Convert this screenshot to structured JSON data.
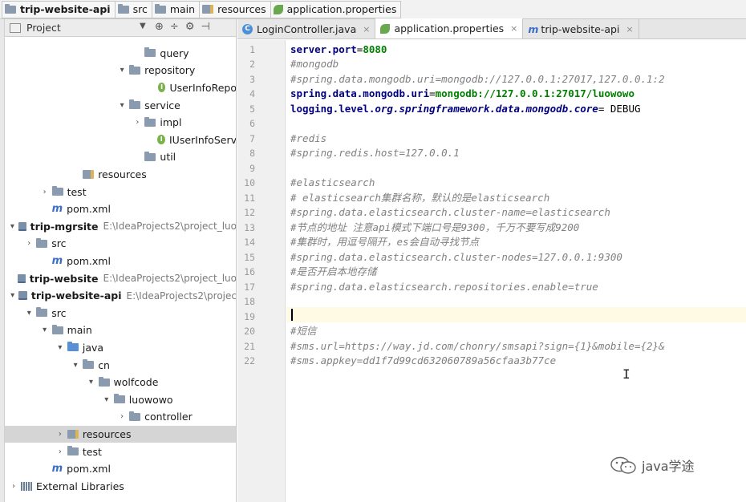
{
  "breadcrumb": [
    {
      "label": "trip-website-api",
      "icon": "module-folder-icon",
      "bold": true
    },
    {
      "label": "src",
      "icon": "folder-icon"
    },
    {
      "label": "main",
      "icon": "folder-icon"
    },
    {
      "label": "resources",
      "icon": "resources-folder-icon"
    },
    {
      "label": "application.properties",
      "icon": "spring-leaf-icon"
    }
  ],
  "project_panel": {
    "title": "Project",
    "tree": [
      {
        "label": "query",
        "depth": 8,
        "icon": "folder",
        "arrow": ""
      },
      {
        "label": "repository",
        "depth": 7,
        "icon": "folder",
        "arrow": "down"
      },
      {
        "label": "UserInfoRepo",
        "depth": 9,
        "icon": "interface",
        "arrow": ""
      },
      {
        "label": "service",
        "depth": 7,
        "icon": "folder",
        "arrow": "down"
      },
      {
        "label": "impl",
        "depth": 8,
        "icon": "folder",
        "arrow": "right"
      },
      {
        "label": "IUserInfoServ",
        "depth": 9,
        "icon": "interface",
        "arrow": ""
      },
      {
        "label": "util",
        "depth": 8,
        "icon": "folder",
        "arrow": ""
      },
      {
        "label": "resources",
        "depth": 4,
        "icon": "resources",
        "arrow": ""
      },
      {
        "label": "test",
        "depth": 2,
        "icon": "folder",
        "arrow": "right"
      },
      {
        "label": "pom.xml",
        "depth": 2,
        "icon": "maven",
        "arrow": ""
      },
      {
        "label": "trip-mgrsite",
        "path": "E:\\IdeaProjects2\\project_luo",
        "depth": 0,
        "icon": "module",
        "arrow": "down",
        "bold": true
      },
      {
        "label": "src",
        "depth": 1,
        "icon": "folder",
        "arrow": "right"
      },
      {
        "label": "pom.xml",
        "depth": 2,
        "icon": "maven",
        "arrow": ""
      },
      {
        "label": "trip-website",
        "path": "E:\\IdeaProjects2\\project_luo",
        "depth": 0,
        "icon": "module",
        "arrow": "",
        "bold": true
      },
      {
        "label": "trip-website-api",
        "path": "E:\\IdeaProjects2\\projec",
        "depth": 0,
        "icon": "module",
        "arrow": "down",
        "bold": true
      },
      {
        "label": "src",
        "depth": 1,
        "icon": "folder",
        "arrow": "down"
      },
      {
        "label": "main",
        "depth": 2,
        "icon": "folder",
        "arrow": "down"
      },
      {
        "label": "java",
        "depth": 3,
        "icon": "folder-blue",
        "arrow": "down"
      },
      {
        "label": "cn",
        "depth": 4,
        "icon": "folder",
        "arrow": "down"
      },
      {
        "label": "wolfcode",
        "depth": 5,
        "icon": "folder",
        "arrow": "down"
      },
      {
        "label": "luowowo",
        "depth": 6,
        "icon": "folder",
        "arrow": "down"
      },
      {
        "label": "controller",
        "depth": 7,
        "icon": "folder",
        "arrow": "right"
      },
      {
        "label": "resources",
        "depth": 3,
        "icon": "resources",
        "arrow": "right",
        "selected": true
      },
      {
        "label": "test",
        "depth": 3,
        "icon": "folder",
        "arrow": "right"
      },
      {
        "label": "pom.xml",
        "depth": 2,
        "icon": "maven",
        "arrow": ""
      },
      {
        "label": "External Libraries",
        "depth": 0,
        "icon": "library",
        "arrow": "right"
      }
    ]
  },
  "tabs": [
    {
      "label": "LoginController.java",
      "icon": "class-c-icon",
      "active": false
    },
    {
      "label": "application.properties",
      "icon": "spring-leaf-icon",
      "active": true
    },
    {
      "label": "trip-website-api",
      "icon": "maven-m-icon",
      "active": false
    }
  ],
  "editor": {
    "lines": [
      {
        "n": "1",
        "kind": "key",
        "key": "server.port",
        "eq": "=",
        "value": "8080"
      },
      {
        "n": "2",
        "kind": "comment",
        "text": "#mongodb"
      },
      {
        "n": "3",
        "kind": "comment",
        "text": "#spring.data.mongodb.uri=mongodb://127.0.0.1:27017,127.0.0.1:2"
      },
      {
        "n": "4",
        "kind": "key",
        "key": "spring.data.mongodb.uri",
        "eq": "=",
        "value": "mongodb://127.0.0.1:27017/luowowo"
      },
      {
        "n": "5",
        "kind": "key_italic",
        "key": "logging.level.",
        "ital": "org.springframework.data.mongodb.core",
        "eq": "= ",
        "value": "DEBUG"
      },
      {
        "n": "6",
        "kind": "empty",
        "text": ""
      },
      {
        "n": "7",
        "kind": "comment",
        "text": "#redis"
      },
      {
        "n": "8",
        "kind": "comment",
        "text": "#spring.redis.host=127.0.0.1"
      },
      {
        "n": "9",
        "kind": "empty",
        "text": ""
      },
      {
        "n": "10",
        "kind": "comment",
        "text": "#elasticsearch"
      },
      {
        "n": "11",
        "kind": "comment",
        "text": "# elasticsearch集群名称，默认的是elasticsearch"
      },
      {
        "n": "12",
        "kind": "comment",
        "text": "#spring.data.elasticsearch.cluster-name=elasticsearch"
      },
      {
        "n": "13",
        "kind": "comment",
        "text": "#节点的地址 注意api模式下端口号是9300，千万不要写成9200"
      },
      {
        "n": "14",
        "kind": "comment",
        "text": "#集群时，用逗号隔开，es会自动寻找节点"
      },
      {
        "n": "15",
        "kind": "comment",
        "text": "#spring.data.elasticsearch.cluster-nodes=127.0.0.1:9300"
      },
      {
        "n": "16",
        "kind": "comment",
        "text": "#是否开启本地存储"
      },
      {
        "n": "17",
        "kind": "comment",
        "text": "#spring.data.elasticsearch.repositories.enable=true"
      },
      {
        "n": "18",
        "kind": "empty",
        "text": ""
      },
      {
        "n": "19",
        "kind": "empty",
        "text": ""
      },
      {
        "n": "20",
        "kind": "comment",
        "text": "#短信"
      },
      {
        "n": "21",
        "kind": "comment",
        "text": "#sms.url=https://way.jd.com/chonry/smsapi?sign={1}&mobile={2}&"
      },
      {
        "n": "22",
        "kind": "comment",
        "text": "#sms.appkey=dd1f7d99cd632060789a56cfaa3b77ce"
      }
    ]
  },
  "watermark": {
    "text": "java学途",
    "icon": "wechat-icon"
  },
  "colors": {
    "key": "#000080",
    "value": "#008000",
    "comment": "#808080",
    "caret_line": "#fffae3"
  }
}
